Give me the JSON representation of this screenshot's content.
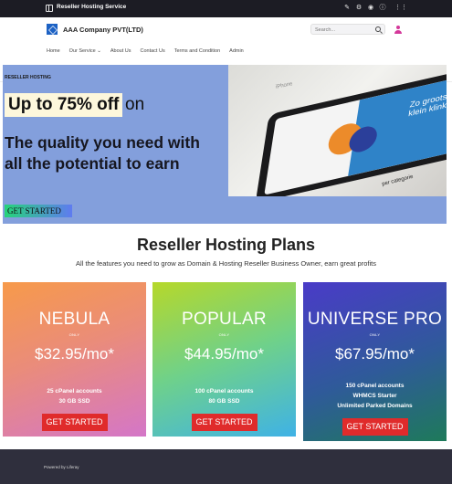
{
  "topbar": {
    "page_name": "Reseller Hosting Service",
    "icons": [
      "sidebar-panel-icon",
      "edit-pencil-icon",
      "gear-icon",
      "simulation-icon",
      "info-icon",
      "grid-menu-icon"
    ]
  },
  "header": {
    "site_name": "AAA Company PVT(LTD)",
    "search_placeholder": "Search...",
    "nav": [
      "Home",
      "Our Service",
      "About Us",
      "Contact Us",
      "Terms and Condition",
      "Admin"
    ]
  },
  "hero": {
    "kicker": "RESELLER HOSTING",
    "discount": "Up to 75% off",
    "discount_suffix": "on",
    "tagline": "The quality you need with all the potential to earn",
    "cta": "GET STARTED",
    "photo_phone_label": "iPhone",
    "photo_screen_text": "Zo groots kan klein klinken",
    "photo_card_text": "per categorie"
  },
  "plans": {
    "title": "Reseller Hosting Plans",
    "subtitle": "All the features you need to grow as Domain & Hosting Reseller Business Owner, earn great profits",
    "cards": [
      {
        "name": "NEBULA",
        "only": "ONLY",
        "price": "$32.95/mo*",
        "features": [
          "25 cPanel accounts",
          "30 GB SSD"
        ],
        "button": "GET STARTED"
      },
      {
        "name": "POPULAR",
        "only": "ONLY",
        "price": "$44.95/mo*",
        "features": [
          "100 cPanel accounts",
          "80 GB SSD"
        ],
        "button": "GET STARTED"
      },
      {
        "name": "UNIVERSE PRO",
        "only": "ONLY",
        "price": "$67.95/mo*",
        "features": [
          "150 cPanel accounts",
          "WHMCS Starter",
          "Unlimited Parked Domains"
        ],
        "button": "GET STARTED"
      }
    ]
  },
  "footer": {
    "powered_by": "Powered by Liferay"
  },
  "colors": {
    "topbar": "#1c1c24",
    "hero_bg": "#839fdc",
    "buy_button": "#e02b2b",
    "footer": "#2f2f3d",
    "brand": "#1d62c4"
  }
}
